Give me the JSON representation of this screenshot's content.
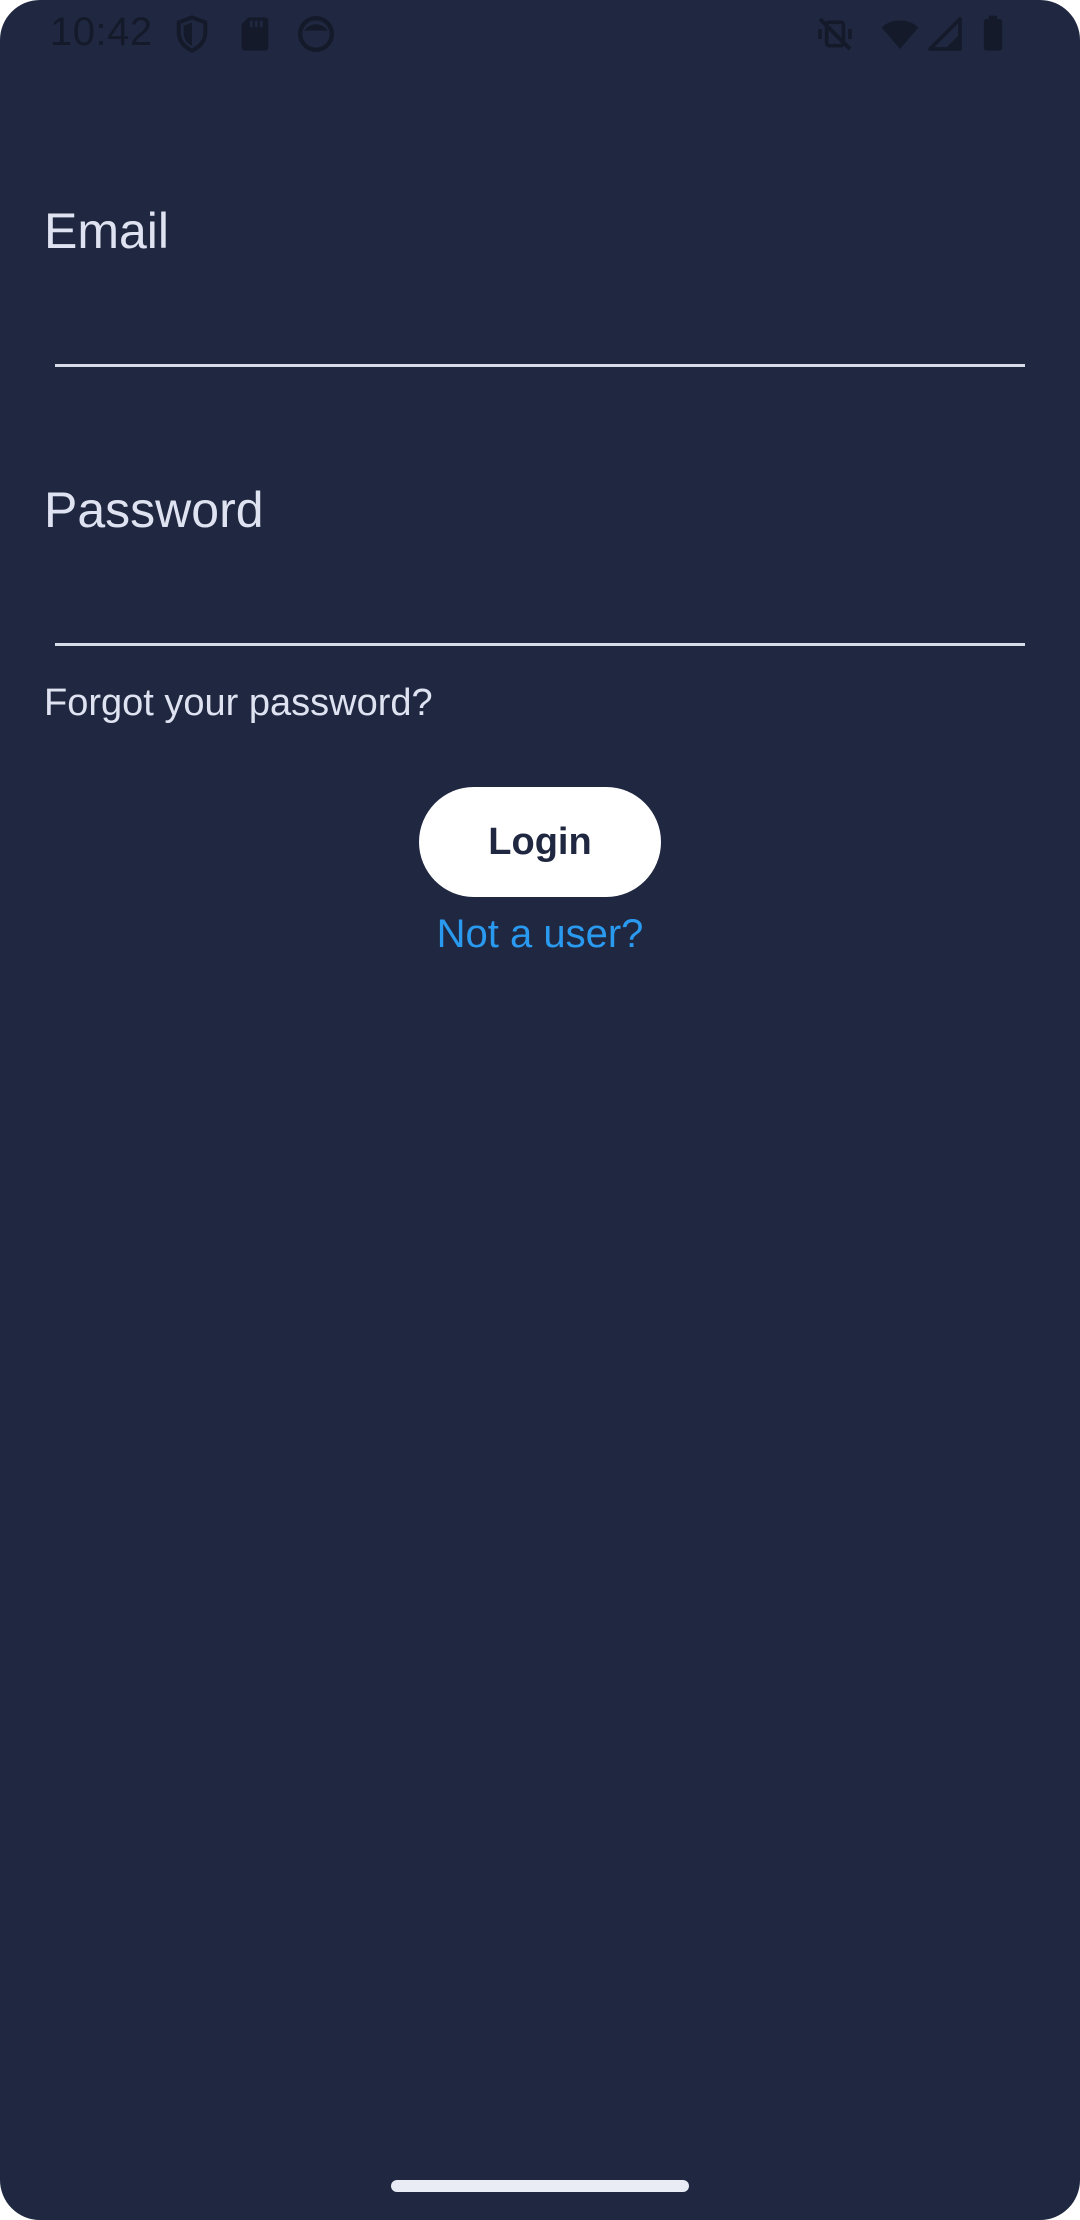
{
  "status_bar": {
    "time": "10:42",
    "left_icons": [
      "shield-icon",
      "sd-card-icon",
      "face-circle-icon"
    ],
    "right_icons": [
      "vibrate-off-icon",
      "wifi-icon",
      "signal-icon",
      "battery-icon"
    ],
    "icon_color": "#141a2a"
  },
  "form": {
    "email_label": "Email",
    "email_value": "",
    "password_label": "Password",
    "password_value": "",
    "forgot_password": "Forgot your password?",
    "login_button": "Login",
    "signup_link": "Not a user?"
  },
  "colors": {
    "background": "#1f2840",
    "label": "#dfe3f1",
    "link_accent": "#2a9af0",
    "button_bg": "#ffffff",
    "button_text": "#1f2840"
  }
}
